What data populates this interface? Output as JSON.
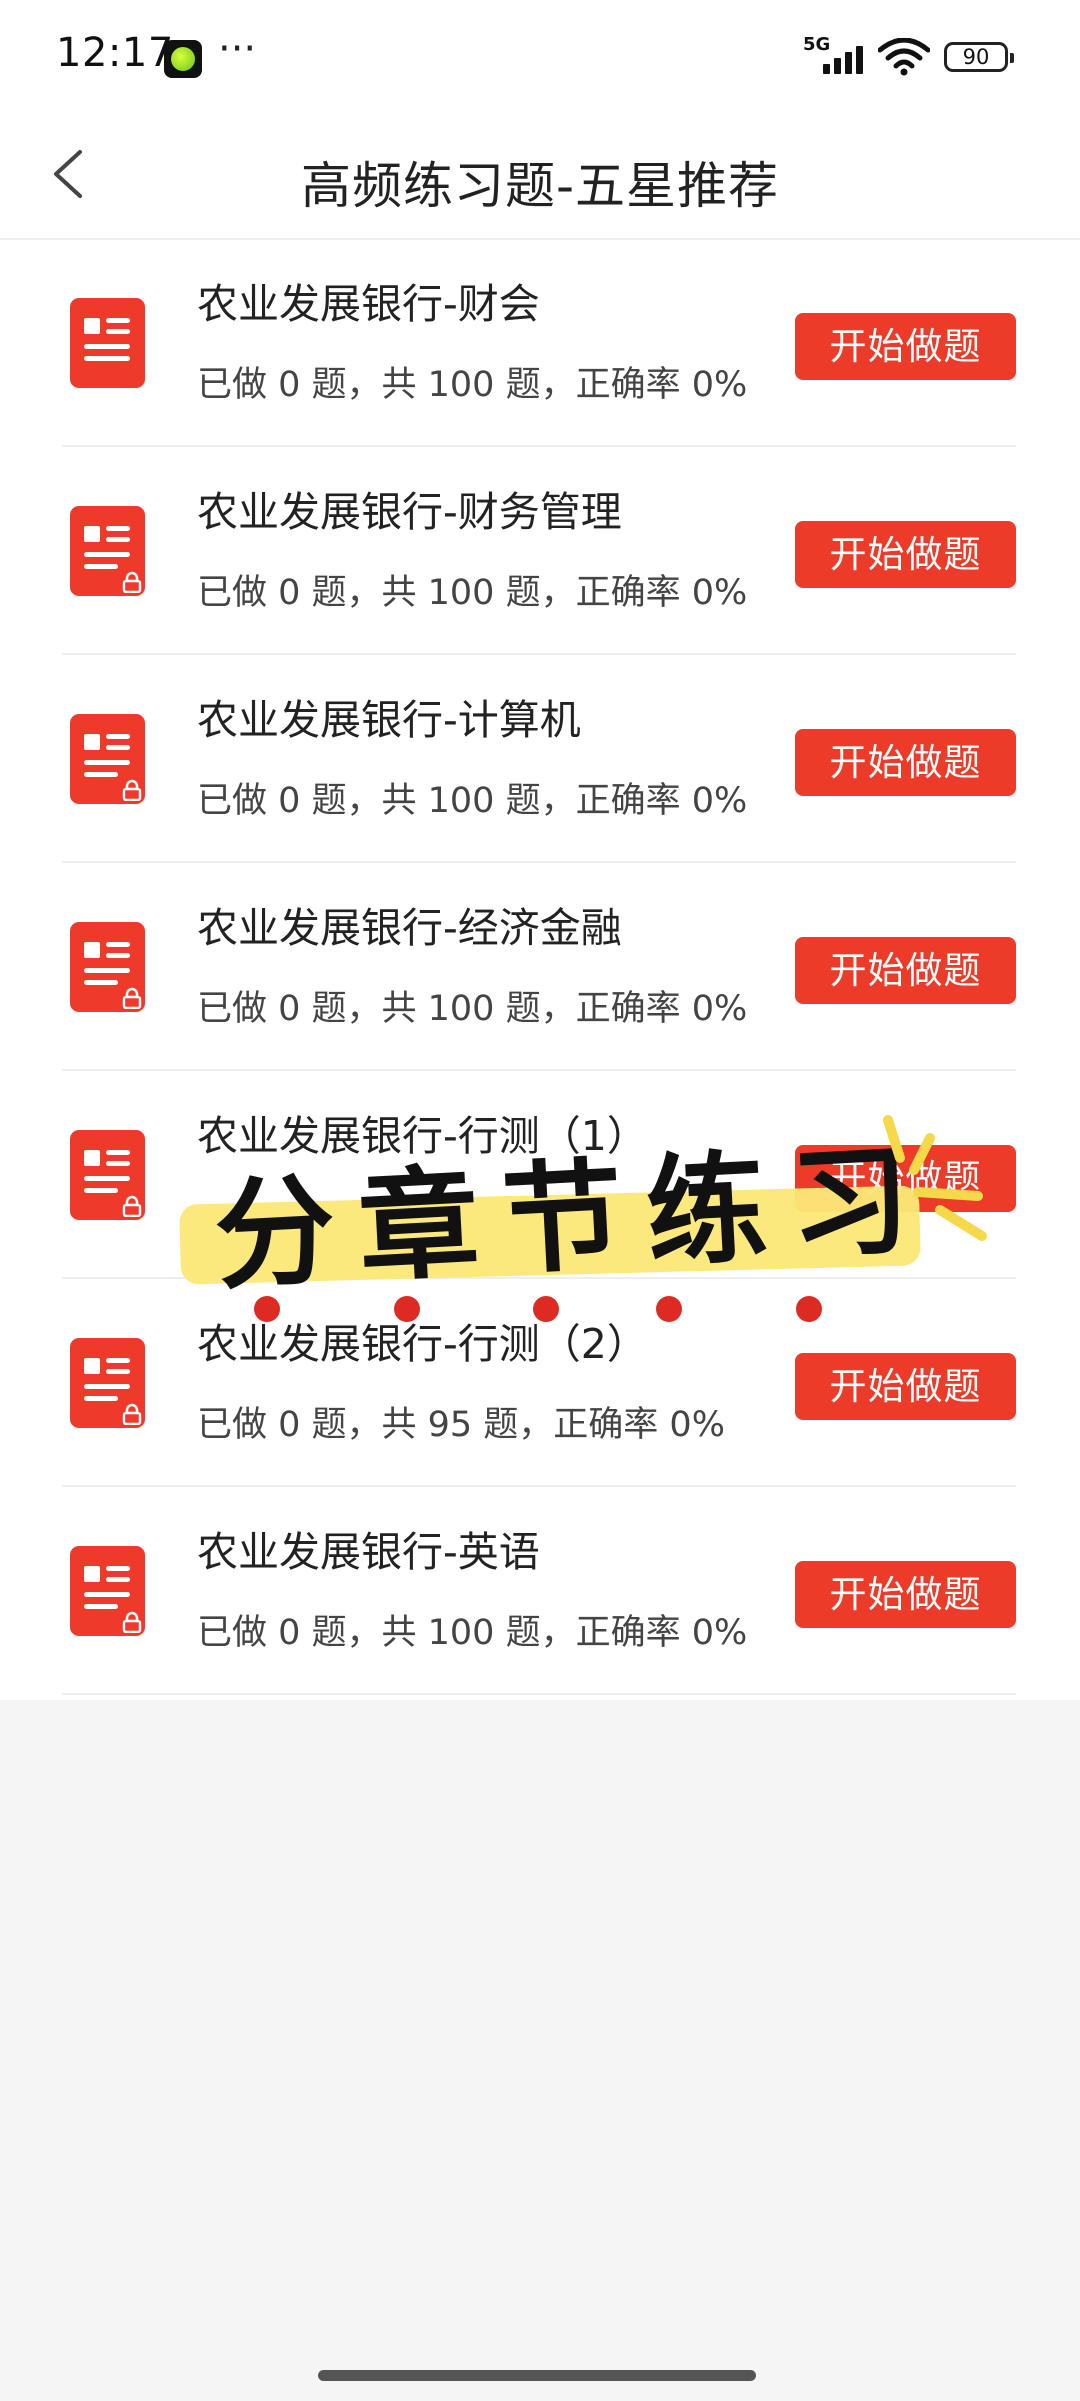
{
  "status_bar": {
    "time": "12:17",
    "signal_label": "5G",
    "battery": "90"
  },
  "nav": {
    "title": "高频练习题-五星推荐"
  },
  "items": [
    {
      "title": "农业发展银行-财会",
      "stats": "已做 0 题，共 100 题，正确率 0%",
      "button": "开始做题",
      "locked": false
    },
    {
      "title": "农业发展银行-财务管理",
      "stats": "已做 0 题，共 100 题，正确率 0%",
      "button": "开始做题",
      "locked": true
    },
    {
      "title": "农业发展银行-计算机",
      "stats": "已做 0 题，共 100 题，正确率 0%",
      "button": "开始做题",
      "locked": true
    },
    {
      "title": "农业发展银行-经济金融",
      "stats": "已做 0 题，共 100 题，正确率 0%",
      "button": "开始做题",
      "locked": true
    },
    {
      "title": "农业发展银行-行测（1）",
      "stats": "",
      "button": "开始做题",
      "locked": true
    },
    {
      "title": "农业发展银行-行测（2）",
      "stats": "已做 0 题，共 95 题，正确率 0%",
      "button": "开始做题",
      "locked": true
    },
    {
      "title": "农业发展银行-英语",
      "stats": "已做 0 题，共 100 题，正确率 0%",
      "button": "开始做题",
      "locked": true
    }
  ],
  "overlay": {
    "text": "分章节练习"
  },
  "colors": {
    "accent": "#ec3b28",
    "icon": "#ee3a2a",
    "highlight": "#fbe878",
    "dot": "#dd2a22"
  }
}
